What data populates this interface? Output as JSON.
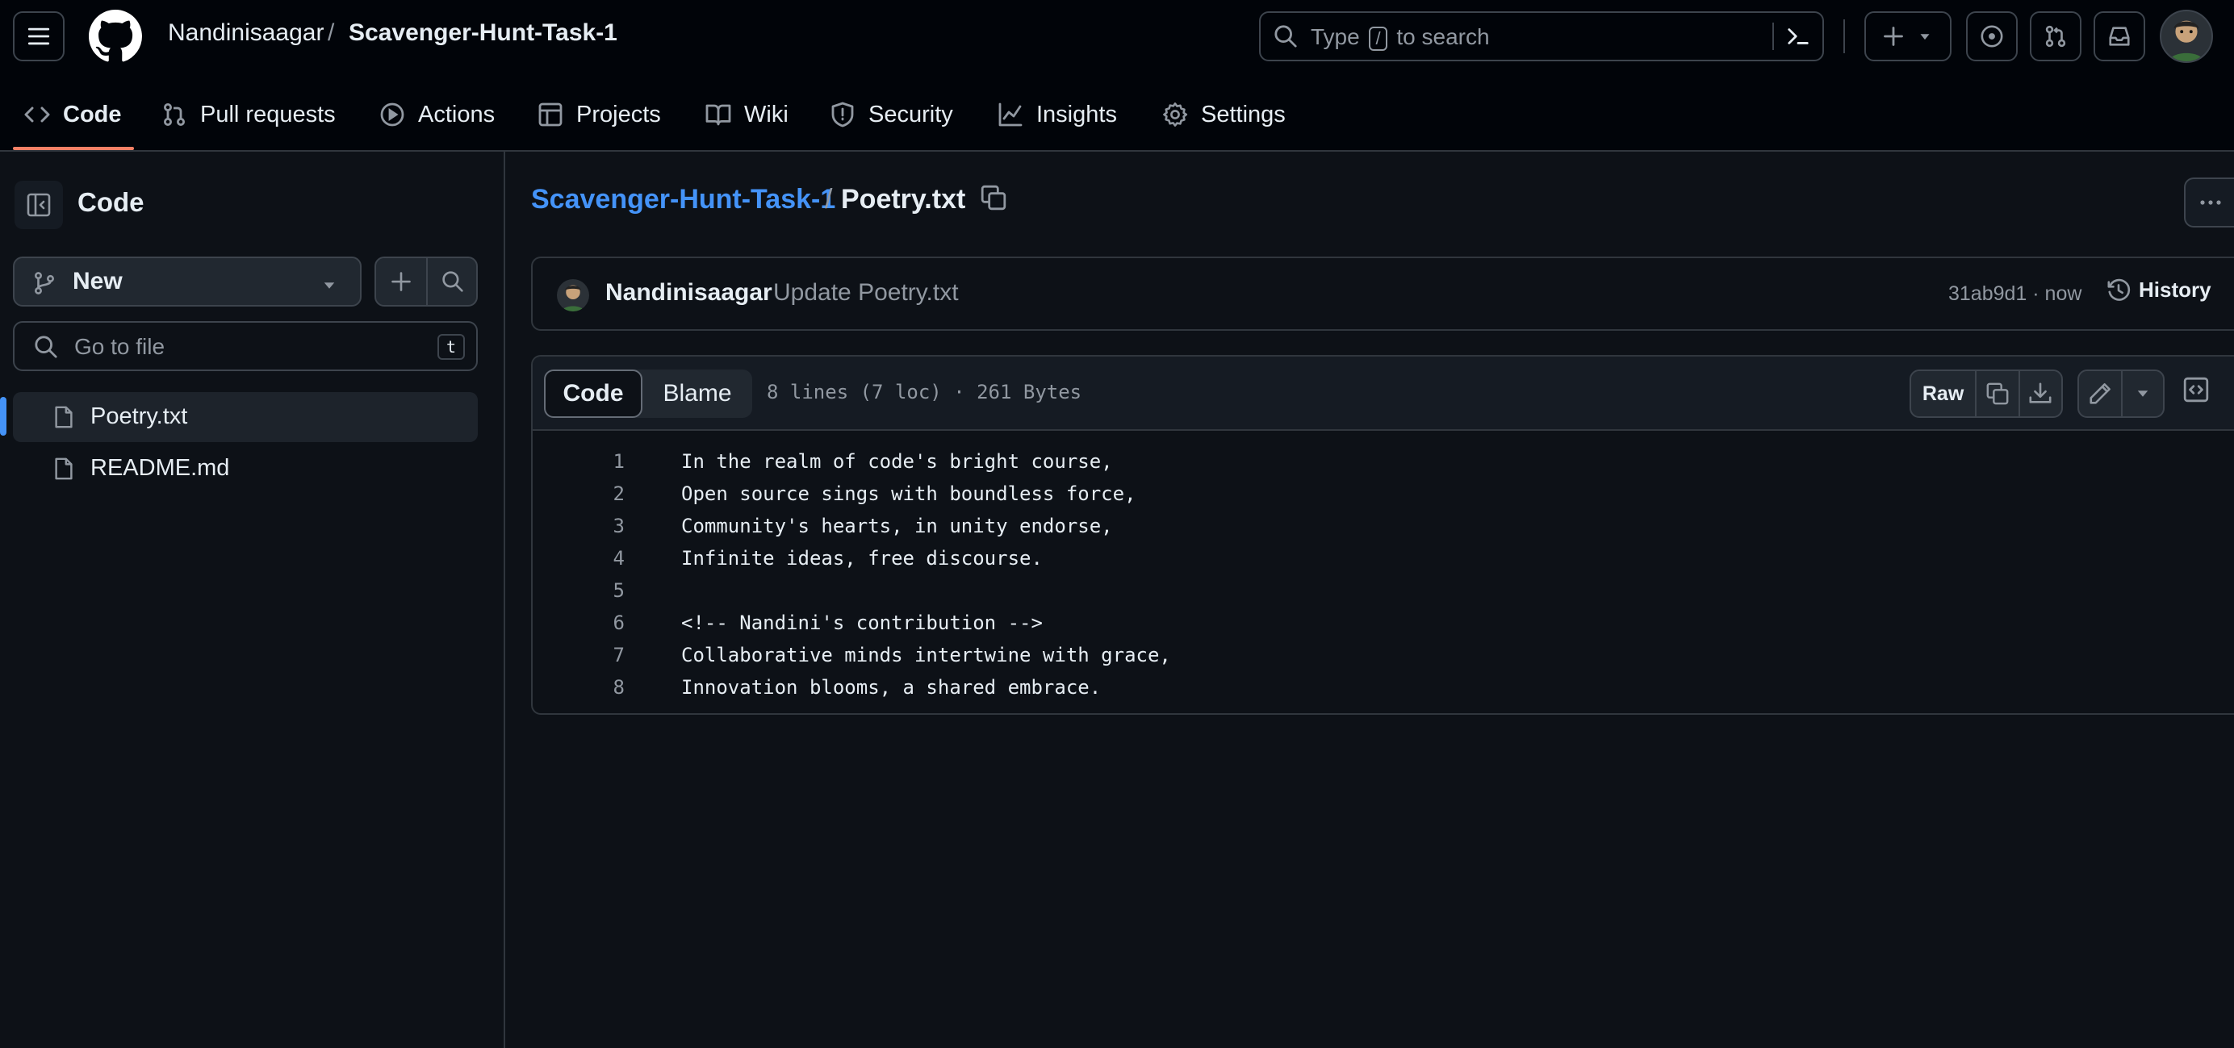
{
  "header": {
    "owner": "Nandinisaagar",
    "separator": "/",
    "repo": "Scavenger-Hunt-Task-1",
    "search_prefix": "Type",
    "search_key": "/",
    "search_suffix": "to search"
  },
  "repo_nav": {
    "items": [
      {
        "label": "Code",
        "icon": "code-icon",
        "active": true
      },
      {
        "label": "Pull requests",
        "icon": "git-pull-request-icon"
      },
      {
        "label": "Actions",
        "icon": "play-icon"
      },
      {
        "label": "Projects",
        "icon": "table-icon"
      },
      {
        "label": "Wiki",
        "icon": "book-icon"
      },
      {
        "label": "Security",
        "icon": "shield-icon"
      },
      {
        "label": "Insights",
        "icon": "graph-icon"
      },
      {
        "label": "Settings",
        "icon": "gear-icon"
      }
    ]
  },
  "sidebar": {
    "title": "Code",
    "branch_label": "New",
    "goto_placeholder": "Go to file",
    "goto_shortcut": "t",
    "files": [
      {
        "name": "Poetry.txt",
        "selected": true
      },
      {
        "name": "README.md",
        "selected": false
      }
    ]
  },
  "breadcrumb": {
    "repo": "Scavenger-Hunt-Task-1",
    "separator": "/",
    "file": "Poetry.txt"
  },
  "commit": {
    "author": "Nandinisaagar",
    "message": "Update Poetry.txt",
    "sha_time": "31ab9d1 · now",
    "history_label": "History"
  },
  "file_view": {
    "tab_code": "Code",
    "tab_blame": "Blame",
    "meta": "8 lines (7 loc) · 261 Bytes",
    "raw_label": "Raw",
    "lines": [
      {
        "n": "1",
        "text": "In the realm of code's bright course,"
      },
      {
        "n": "2",
        "text": "Open source sings with boundless force,"
      },
      {
        "n": "3",
        "text": "Community's hearts, in unity endorse,"
      },
      {
        "n": "4",
        "text": "Infinite ideas, free discourse."
      },
      {
        "n": "5",
        "text": ""
      },
      {
        "n": "6",
        "text": "<!-- Nandini's contribution -->"
      },
      {
        "n": "7",
        "text": "Collaborative minds intertwine with grace,"
      },
      {
        "n": "8",
        "text": "Innovation blooms, a shared embrace."
      }
    ]
  },
  "colors": {
    "accent_link": "#4493f8",
    "nav_underline": "#f78166",
    "background": "#0d1117"
  }
}
